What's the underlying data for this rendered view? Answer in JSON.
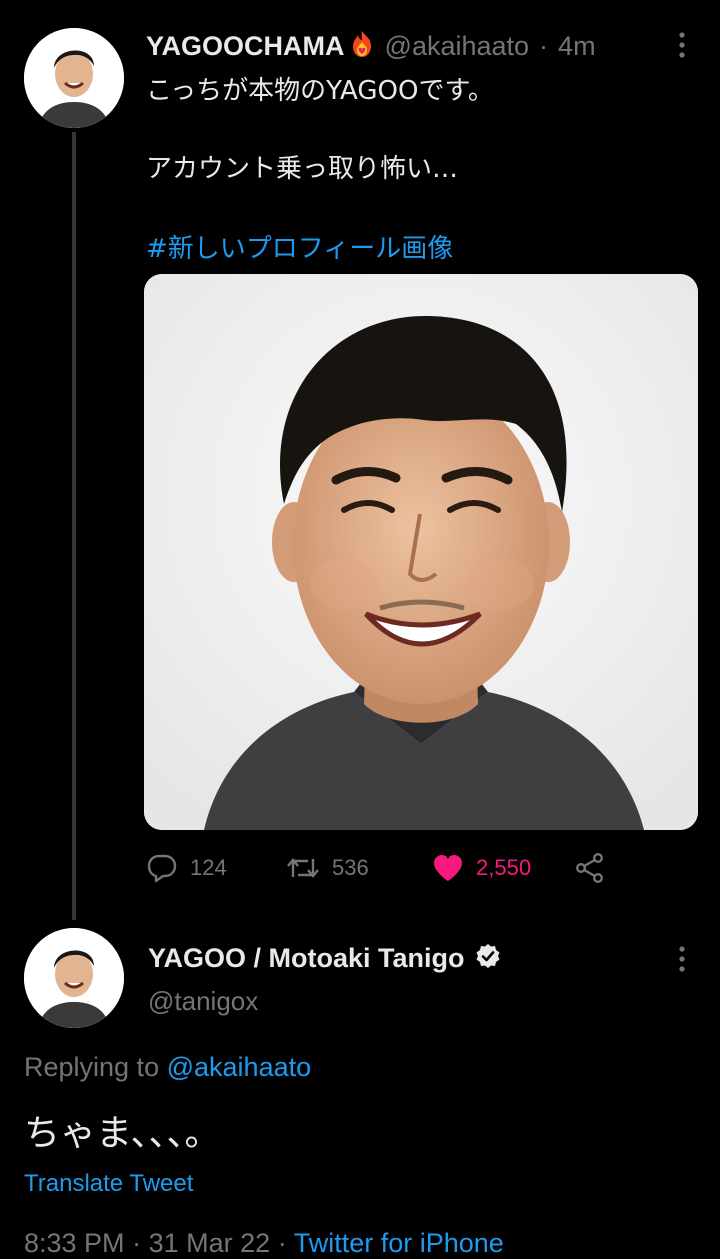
{
  "colors": {
    "background": "#000000",
    "text_primary": "#e7e9ea",
    "text_secondary": "#71767b",
    "link": "#1d9bf0",
    "like": "#f91880"
  },
  "tweet": {
    "display_name": "YAGOOCHAMA",
    "name_emoji": "fire-heart-icon",
    "handle": "@akaihaato",
    "separator": "·",
    "time": "4m",
    "text_line1": "こっちが本物のYAGOOです。",
    "text_line2": "アカウント乗っ取り怖い…",
    "hashtag": "#新しいプロフィール画像",
    "actions": {
      "replies": "124",
      "retweets": "536",
      "likes": "2,550"
    }
  },
  "reply": {
    "display_name": "YAGOO / Motoaki Tanigo",
    "verified_icon": "verified-badge-icon",
    "handle": "@tanigox",
    "replying_label": "Replying to",
    "replying_handle": "@akaihaato",
    "text": "ちゃま、、、。",
    "translate_label": "Translate Tweet",
    "time": "8:33 PM",
    "date": "31 Mar 22",
    "separator": "·",
    "source": "Twitter for iPhone"
  }
}
